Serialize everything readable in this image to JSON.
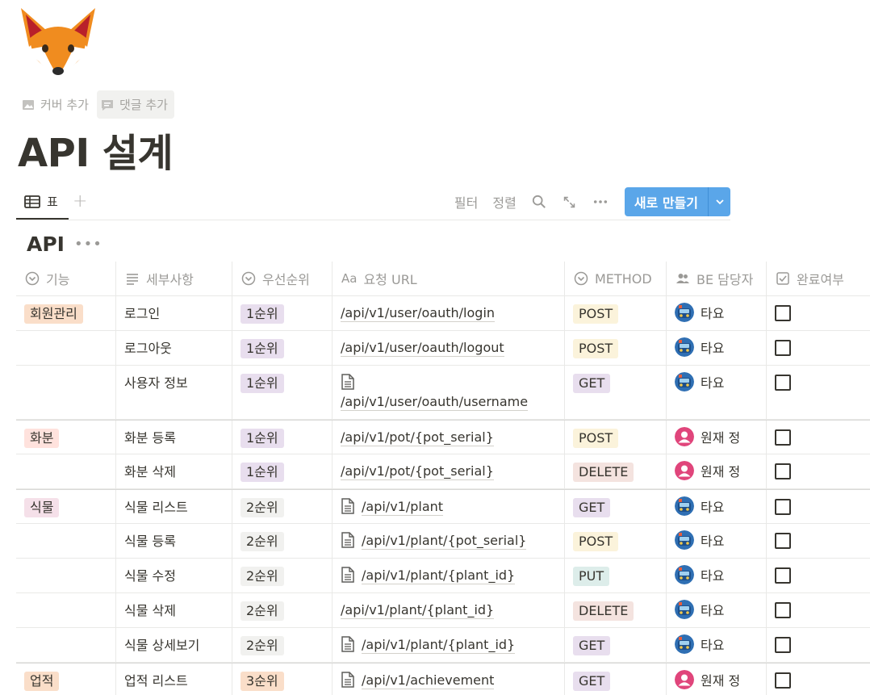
{
  "page": {
    "icon": "fox-icon",
    "actions": {
      "add_cover": "커버 추가",
      "add_comment": "댓글 추가"
    },
    "title": "API 설계"
  },
  "view": {
    "tab_label": "표",
    "toolbar": {
      "filter": "필터",
      "sort": "정렬",
      "new_button": "새로 만들기"
    }
  },
  "database": {
    "title": "API",
    "columns": [
      {
        "label": "기능",
        "icon": "select-icon"
      },
      {
        "label": "세부사항",
        "icon": "text-icon"
      },
      {
        "label": "우선순위",
        "icon": "select-icon"
      },
      {
        "label": "요청 URL",
        "icon": "title-icon"
      },
      {
        "label": "METHOD",
        "icon": "select-icon"
      },
      {
        "label": "BE 담당자",
        "icon": "person-icon"
      },
      {
        "label": "완료여부",
        "icon": "checkbox-icon"
      }
    ],
    "rows": [
      {
        "feature": "회원관리",
        "detail": "로그인",
        "priority": "1순위",
        "url": "/api/v1/user/oauth/login",
        "method": "POST",
        "owner": "타요",
        "done": false
      },
      {
        "feature": "",
        "detail": "로그아웃",
        "priority": "1순위",
        "url": "/api/v1/user/oauth/logout",
        "method": "POST",
        "owner": "타요",
        "done": false
      },
      {
        "feature": "",
        "detail": "사용자 정보",
        "priority": "1순위",
        "url": "/api/v1/user/oauth/username",
        "method": "GET",
        "owner": "타요",
        "done": false
      },
      {
        "feature": "화분",
        "detail": "화분 등록",
        "priority": "1순위",
        "url": "/api/v1/pot/{pot_serial}",
        "method": "POST",
        "owner": "원재 정",
        "done": false
      },
      {
        "feature": "",
        "detail": "화분 삭제",
        "priority": "1순위",
        "url": "/api/v1/pot/{pot_serial}",
        "method": "DELETE",
        "owner": "원재 정",
        "done": false
      },
      {
        "feature": "식물",
        "detail": "식물 리스트",
        "priority": "2순위",
        "url": "/api/v1/plant",
        "method": "GET",
        "owner": "타요",
        "done": false
      },
      {
        "feature": "",
        "detail": "식물 등록",
        "priority": "2순위",
        "url": "/api/v1/plant/{pot_serial}",
        "method": "POST",
        "owner": "타요",
        "done": false
      },
      {
        "feature": "",
        "detail": "식물 수정",
        "priority": "2순위",
        "url": "/api/v1/plant/{plant_id}",
        "method": "PUT",
        "owner": "타요",
        "done": false
      },
      {
        "feature": "",
        "detail": "식물 삭제",
        "priority": "2순위",
        "url": "/api/v1/plant/{plant_id}",
        "method": "DELETE",
        "owner": "타요",
        "done": false
      },
      {
        "feature": "",
        "detail": "식물 상세보기",
        "priority": "2순위",
        "url": "/api/v1/plant/{plant_id}",
        "method": "GET",
        "owner": "타요",
        "done": false
      },
      {
        "feature": "업적",
        "detail": "업적 리스트",
        "priority": "3순위",
        "url": "/api/v1/achievement",
        "method": "GET",
        "owner": "원재 정",
        "done": false
      }
    ]
  },
  "colors": {
    "accent": "#5aa6e9",
    "tag_회원관리": "#fadec9",
    "tag_화분": "#ffe2dd",
    "tag_식물": "#f5e0e9",
    "tag_업적": "#fadec9",
    "tag_1순위": "#e8deee",
    "tag_2순위": "#f1f1ef",
    "tag_3순위": "#fadec9",
    "method_POST": "#fbf3db",
    "method_GET": "#e8deee",
    "method_DELETE": "#f4e3df",
    "method_PUT": "#ddedea"
  }
}
